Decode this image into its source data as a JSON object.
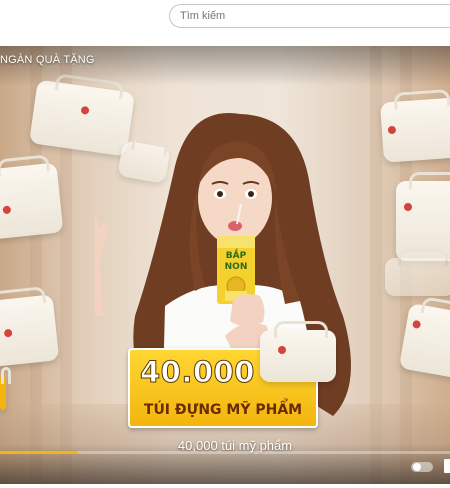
{
  "search": {
    "placeholder": "Tìm kiếm"
  },
  "video": {
    "title": "NGÀN QUÀ TẶNG",
    "caption": "40,000 túi mỹ phẩm",
    "progress": 0.17,
    "accent_color": "#f3b50e"
  },
  "promo": {
    "number": "40.000",
    "label": "TÚI ĐỰNG MỸ PHẨM"
  },
  "product": {
    "brand_line1": "BẮP",
    "brand_line2": "NON"
  },
  "icons": {
    "autoplay_toggle": "pause-toggle-icon",
    "settings": "settings-icon"
  }
}
